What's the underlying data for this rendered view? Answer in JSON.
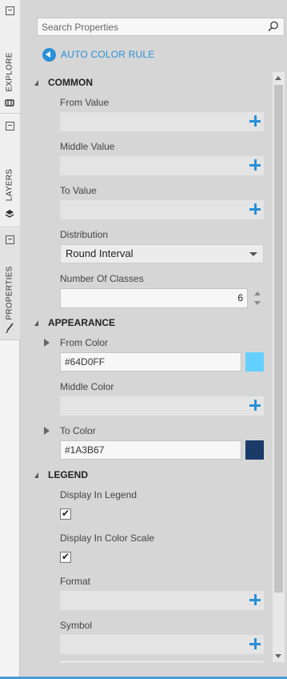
{
  "tabs": [
    {
      "label": "EXPLORE",
      "icon": "database-icon"
    },
    {
      "label": "LAYERS",
      "icon": "layers-icon"
    },
    {
      "label": "PROPERTIES",
      "icon": "brush-icon"
    }
  ],
  "search": {
    "placeholder": "Search Properties",
    "value": ""
  },
  "back_link": {
    "label": "AUTO COLOR RULE"
  },
  "sections": {
    "common": {
      "title": "COMMON",
      "from_value": {
        "label": "From Value",
        "value": ""
      },
      "middle_value": {
        "label": "Middle Value",
        "value": ""
      },
      "to_value": {
        "label": "To Value",
        "value": ""
      },
      "distribution": {
        "label": "Distribution",
        "value": "Round Interval"
      },
      "number_of_classes": {
        "label": "Number Of Classes",
        "value": "6"
      }
    },
    "appearance": {
      "title": "APPEARANCE",
      "from_color": {
        "label": "From Color",
        "value": "#64D0FF",
        "swatch": "#64D0FF"
      },
      "middle_color": {
        "label": "Middle Color",
        "value": ""
      },
      "to_color": {
        "label": "To Color",
        "value": "#1A3B67",
        "swatch": "#1A3B67"
      }
    },
    "legend": {
      "title": "LEGEND",
      "display_in_legend": {
        "label": "Display In Legend",
        "checked": true
      },
      "display_in_color_scale": {
        "label": "Display In Color Scale",
        "checked": true
      },
      "format": {
        "label": "Format",
        "value": ""
      },
      "symbol": {
        "label": "Symbol",
        "value": ""
      }
    }
  },
  "colors": {
    "accent": "#2A8FD6",
    "panel_bg": "#D6D6D6",
    "field_bg": "#E4E4E4"
  }
}
